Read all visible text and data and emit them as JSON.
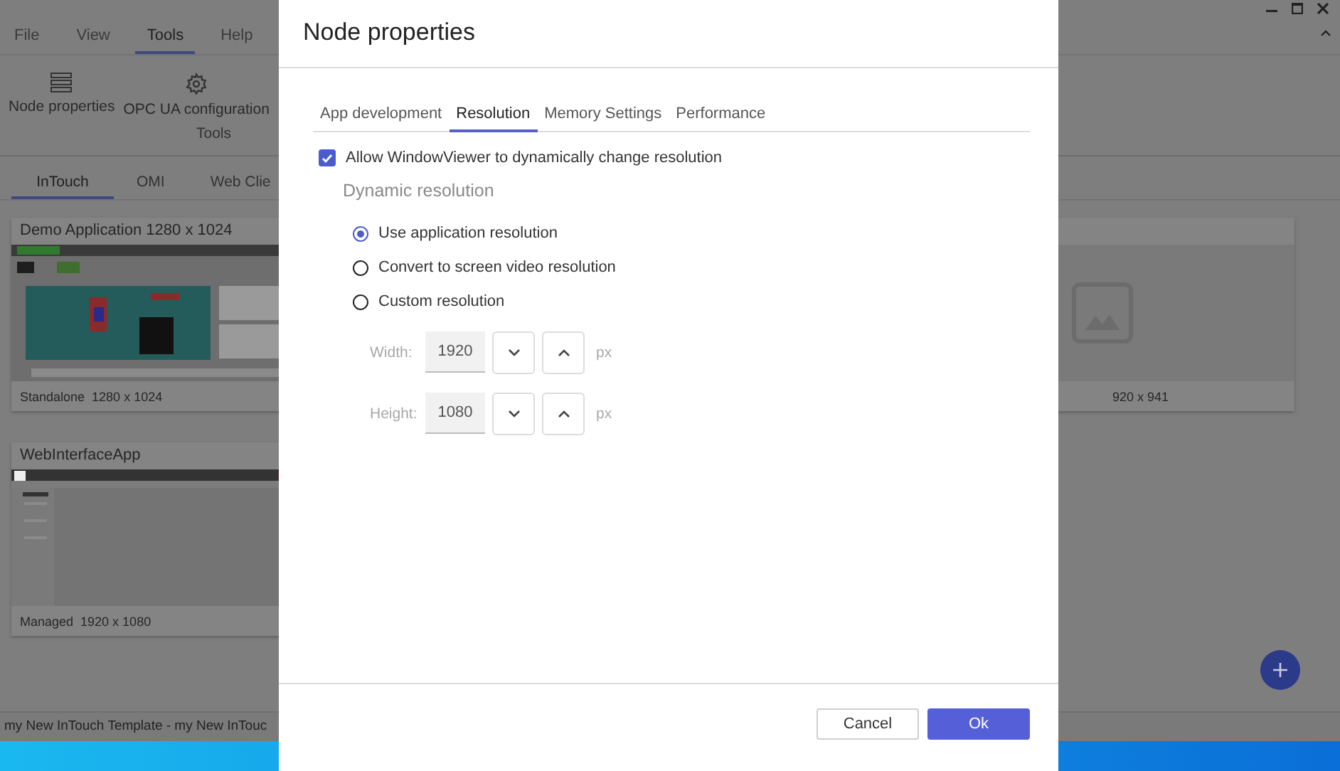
{
  "menu": [
    {
      "label": "File",
      "selected": false
    },
    {
      "label": "View",
      "selected": false
    },
    {
      "label": "Tools",
      "selected": true
    },
    {
      "label": "Help",
      "selected": false
    }
  ],
  "ribbon": {
    "items": [
      {
        "label": "Node properties",
        "kind": "list"
      },
      {
        "label": "OPC UA configuration",
        "kind": "gear"
      }
    ],
    "group": "Tools"
  },
  "app_tabs": [
    {
      "label": "InTouch",
      "selected": true
    },
    {
      "label": "OMI",
      "selected": false
    },
    {
      "label": "Web Clie",
      "selected": false
    }
  ],
  "cards": [
    {
      "title": "Demo Application 1280 x 1024",
      "caption": "Standalone  1280 x 1024",
      "kind": "hmi"
    },
    {
      "caption": "920 x 941",
      "kind": "placeholder"
    },
    {
      "title": "WebInterfaceApp",
      "caption": "Managed  1920 x 1080",
      "kind": "web"
    }
  ],
  "status_bar": "my New InTouch Template - my New InTouc",
  "dialog": {
    "title": "Node properties",
    "tabs": [
      {
        "label": "App development",
        "selected": false
      },
      {
        "label": "Resolution",
        "selected": true
      },
      {
        "label": "Memory Settings",
        "selected": false
      },
      {
        "label": "Performance",
        "selected": false
      }
    ],
    "allow": {
      "label": "Allow WindowViewer to dynamically change resolution",
      "checked": true
    },
    "section": "Dynamic resolution",
    "options": [
      {
        "label": "Use application resolution",
        "selected": true
      },
      {
        "label": "Convert to screen video resolution",
        "selected": false
      },
      {
        "label": "Custom resolution",
        "selected": false
      }
    ],
    "sizes": [
      {
        "label": "Width:",
        "value": "1920",
        "unit": "px",
        "disabled": true
      },
      {
        "label": "Height:",
        "value": "1080",
        "unit": "px",
        "disabled": true
      }
    ],
    "buttons": [
      {
        "label": "Cancel",
        "kind": "secondary"
      },
      {
        "label": "Ok",
        "kind": "primary"
      }
    ]
  }
}
